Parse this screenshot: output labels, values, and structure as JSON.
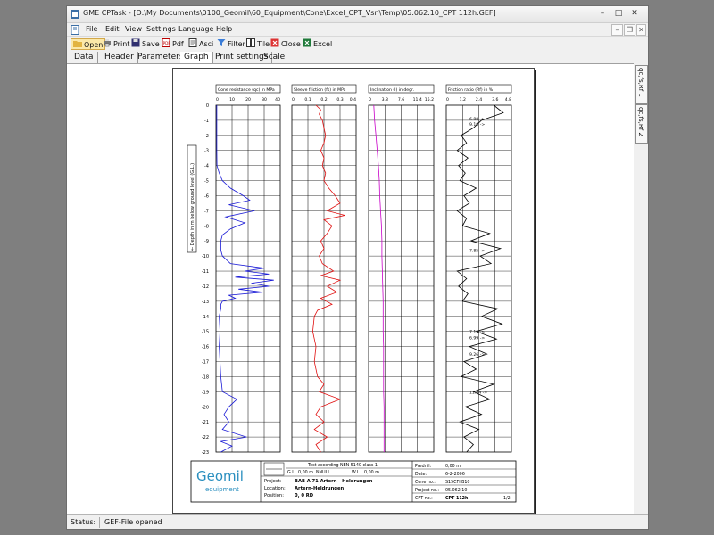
{
  "window": {
    "title": "GME CPTask - [D:\\My Documents\\0100_Geomil\\60_Equipment\\Cone\\Excel_CPT_Vsn\\Temp\\05.062.10_CPT 112h.GEF]"
  },
  "menu": [
    "File",
    "Edit",
    "View",
    "Settings",
    "Language",
    "Help"
  ],
  "toolbar": {
    "open": "Open",
    "print": "Print",
    "save": "Save",
    "pdf": "Pdf",
    "ascii": "Asci",
    "filter": "Filter",
    "tile": "Tile",
    "close": "Close",
    "excel": "Excel"
  },
  "tabs": [
    "Data",
    "Header",
    "Parameters",
    "Graph",
    "Print settings",
    "Scale"
  ],
  "active_tab": "Graph",
  "side_tabs": [
    "qc,fs,Rf 1",
    "qc,fs,Rf 2"
  ],
  "status": {
    "label": "Status:",
    "value": "GEF-File opened"
  },
  "colors": {
    "cone": "#1a1ad6",
    "friction": "#e01010",
    "inclination": "#c800c8",
    "ratio": "#000000",
    "logo": "#2a8fbf"
  },
  "chart_data": {
    "type": "line",
    "ylabel": "←  Depth in m below ground level (G.L.)",
    "depth_ticks": [
      "0",
      "-1",
      "-2",
      "-3",
      "-4",
      "-5",
      "-6",
      "-7",
      "-8",
      "-9",
      "-10",
      "-11",
      "-12",
      "-13",
      "-14",
      "-15",
      "-16",
      "-17",
      "-18",
      "-19",
      "-20",
      "-21",
      "-22",
      "-23"
    ],
    "ylim": [
      -23,
      0
    ],
    "grid": true,
    "panels": [
      {
        "name": "cone",
        "title": "Cone resistance (qc) in MPa",
        "ticks": [
          "0",
          "10",
          "20",
          "30",
          "40"
        ],
        "xlim": [
          0,
          40
        ],
        "series": [
          {
            "depth": [
              0,
              -1,
              -2,
              -3,
              -4,
              -4.5,
              -5,
              -5.5,
              -6,
              -6.3,
              -6.6,
              -7,
              -7.4,
              -7.8,
              -8.2,
              -8.6,
              -9,
              -9.6,
              -10,
              -10.5,
              -10.8,
              -11,
              -11.2,
              -11.4,
              -11.6,
              -11.8,
              -12,
              -12.2,
              -12.4,
              -12.6,
              -12.8,
              -13,
              -13.2,
              -13.5,
              -14,
              -15,
              -16,
              -17,
              -18,
              -19,
              -19.5,
              -20,
              -20.5,
              -21,
              -21.5,
              -22,
              -22.3,
              -22.6,
              -23
            ],
            "qc": [
              0.5,
              0.5,
              0.5,
              0.5,
              0.6,
              2,
              4,
              9,
              17,
              21,
              8,
              24,
              6,
              18,
              9,
              4,
              3,
              3,
              4,
              9,
              30,
              18,
              33,
              12,
              36,
              22,
              33,
              14,
              29,
              8,
              12,
              4,
              3,
              3,
              2,
              2.5,
              2,
              2.5,
              3,
              4,
              13,
              8,
              5,
              8,
              4,
              19,
              3,
              10,
              3
            ]
          }
        ]
      },
      {
        "name": "friction",
        "title": "Sleeve friction (fs) in MPa",
        "ticks": [
          "0",
          "0.1",
          "0.2",
          "0.3",
          "0.4"
        ],
        "xlim": [
          0,
          0.4
        ],
        "series": [
          {
            "depth": [
              0,
              -0.3,
              -0.6,
              -1,
              -1.5,
              -2,
              -2.5,
              -3,
              -3.5,
              -4,
              -4.5,
              -5,
              -5.5,
              -6,
              -6.5,
              -7,
              -7.3,
              -7.6,
              -8,
              -8.5,
              -9,
              -9.5,
              -10,
              -10.5,
              -11,
              -11.3,
              -11.6,
              -12,
              -12.4,
              -12.8,
              -13.2,
              -13.6,
              -14,
              -15,
              -16,
              -17,
              -18,
              -18.5,
              -19,
              -19.5,
              -20,
              -20.5,
              -21,
              -21.5,
              -22,
              -22.5,
              -23
            ],
            "fs": [
              0.15,
              0.18,
              0.17,
              0.19,
              0.2,
              0.21,
              0.2,
              0.18,
              0.2,
              0.19,
              0.21,
              0.2,
              0.23,
              0.27,
              0.3,
              0.22,
              0.33,
              0.2,
              0.25,
              0.22,
              0.18,
              0.2,
              0.17,
              0.19,
              0.26,
              0.18,
              0.3,
              0.22,
              0.28,
              0.18,
              0.25,
              0.16,
              0.14,
              0.13,
              0.15,
              0.14,
              0.16,
              0.2,
              0.17,
              0.3,
              0.18,
              0.15,
              0.2,
              0.14,
              0.22,
              0.15,
              0.18
            ]
          }
        ]
      },
      {
        "name": "inclination",
        "title": "Inclination (I) in degr.",
        "ticks": [
          "0",
          "3.8",
          "7.6",
          "11.4",
          "15.2"
        ],
        "xlim": [
          0,
          15.2
        ],
        "series": [
          {
            "depth": [
              0,
              -1,
              -2,
              -3,
              -4,
              -5,
              -6,
              -7,
              -8,
              -9,
              -10,
              -11,
              -12,
              -13,
              -14,
              -15,
              -16,
              -17,
              -18,
              -19,
              -20,
              -21,
              -22,
              -23
            ],
            "incl": [
              1.2,
              1.4,
              1.7,
              2.0,
              2.3,
              2.5,
              2.6,
              2.8,
              3.0,
              3.1,
              3.1,
              3.2,
              3.3,
              3.4,
              3.4,
              3.4,
              3.5,
              3.5,
              3.5,
              3.5,
              3.6,
              3.6,
              3.6,
              3.6
            ]
          }
        ]
      },
      {
        "name": "ratio",
        "title": "Friction ratio (Rf) in %",
        "ticks": [
          "0",
          "1.2",
          "2.4",
          "3.6",
          "4.8"
        ],
        "xlim": [
          0,
          4.8
        ],
        "series": [
          {
            "depth": [
              0,
              -0.5,
              -1,
              -1.5,
              -2,
              -2.5,
              -3,
              -3.5,
              -4,
              -4.5,
              -5,
              -5.5,
              -6,
              -6.5,
              -7,
              -7.5,
              -8,
              -8.5,
              -9,
              -9.5,
              -10,
              -10.5,
              -11,
              -11.5,
              -12,
              -12.5,
              -13,
              -13.5,
              -14,
              -14.5,
              -15,
              -15.5,
              -16,
              -16.5,
              -17,
              -17.5,
              -18,
              -18.5,
              -19,
              -19.5,
              -20,
              -20.5,
              -21,
              -21.5,
              -22,
              -22.5,
              -23
            ],
            "rf": [
              3.5,
              4.2,
              2.6,
              2.0,
              1.1,
              1.5,
              0.8,
              1.6,
              0.9,
              1.4,
              1.0,
              2.2,
              1.3,
              1.7,
              0.8,
              1.5,
              1.2,
              3.2,
              1.8,
              4.0,
              2.5,
              3.3,
              0.8,
              1.5,
              0.9,
              1.6,
              1.2,
              3.8,
              2.6,
              4.1,
              2.2,
              3.7,
              1.7,
              3.0,
              1.3,
              2.2,
              1.1,
              3.5,
              2.0,
              3.2,
              1.4,
              2.6,
              1.0,
              2.4,
              1.3,
              2.0,
              1.5
            ]
          }
        ],
        "annotations": [
          {
            "depth": -0.9,
            "text": "6.88 ->"
          },
          {
            "depth": -1.25,
            "text": "9.16 ->"
          },
          {
            "depth": -9.6,
            "text": "7.85 ->"
          },
          {
            "depth": -15.0,
            "text": "7.11 ->"
          },
          {
            "depth": -15.4,
            "text": "6.99 ->"
          },
          {
            "depth": -16.5,
            "text": "9.26 ->"
          },
          {
            "depth": -19.0,
            "text": "11.34 ->"
          }
        ]
      }
    ]
  },
  "footer": {
    "logo_main": "Geomil",
    "logo_sub": "equipment",
    "test_text": "Test according NEN 5140 class 1",
    "gl_label": "G.L.",
    "gl_value": "0,00 m",
    "gl_ref": "NNULL",
    "wl_label": "W.L.",
    "wl_value": "0,00 m",
    "project_label": "Project:",
    "project_value": "BAB A 71 Artern - Heldrungen",
    "location_label": "Location:",
    "location_value": "Artern-Heldrungen",
    "position_label": "Position:",
    "position_value": "0, 0 RD",
    "predrill_label": "Predrill:",
    "predrill_value": "0,00 m",
    "date_label": "Date:",
    "date_value": "6-2-2006",
    "cone_label": "Cone no.:",
    "cone_value": "S15CFIIB10",
    "projectno_label": "Project no.:",
    "projectno_value": "05.062.10",
    "cptno_label": "CPT no.:",
    "cptno_value": "CPT 112h",
    "sheet": "1/2"
  }
}
